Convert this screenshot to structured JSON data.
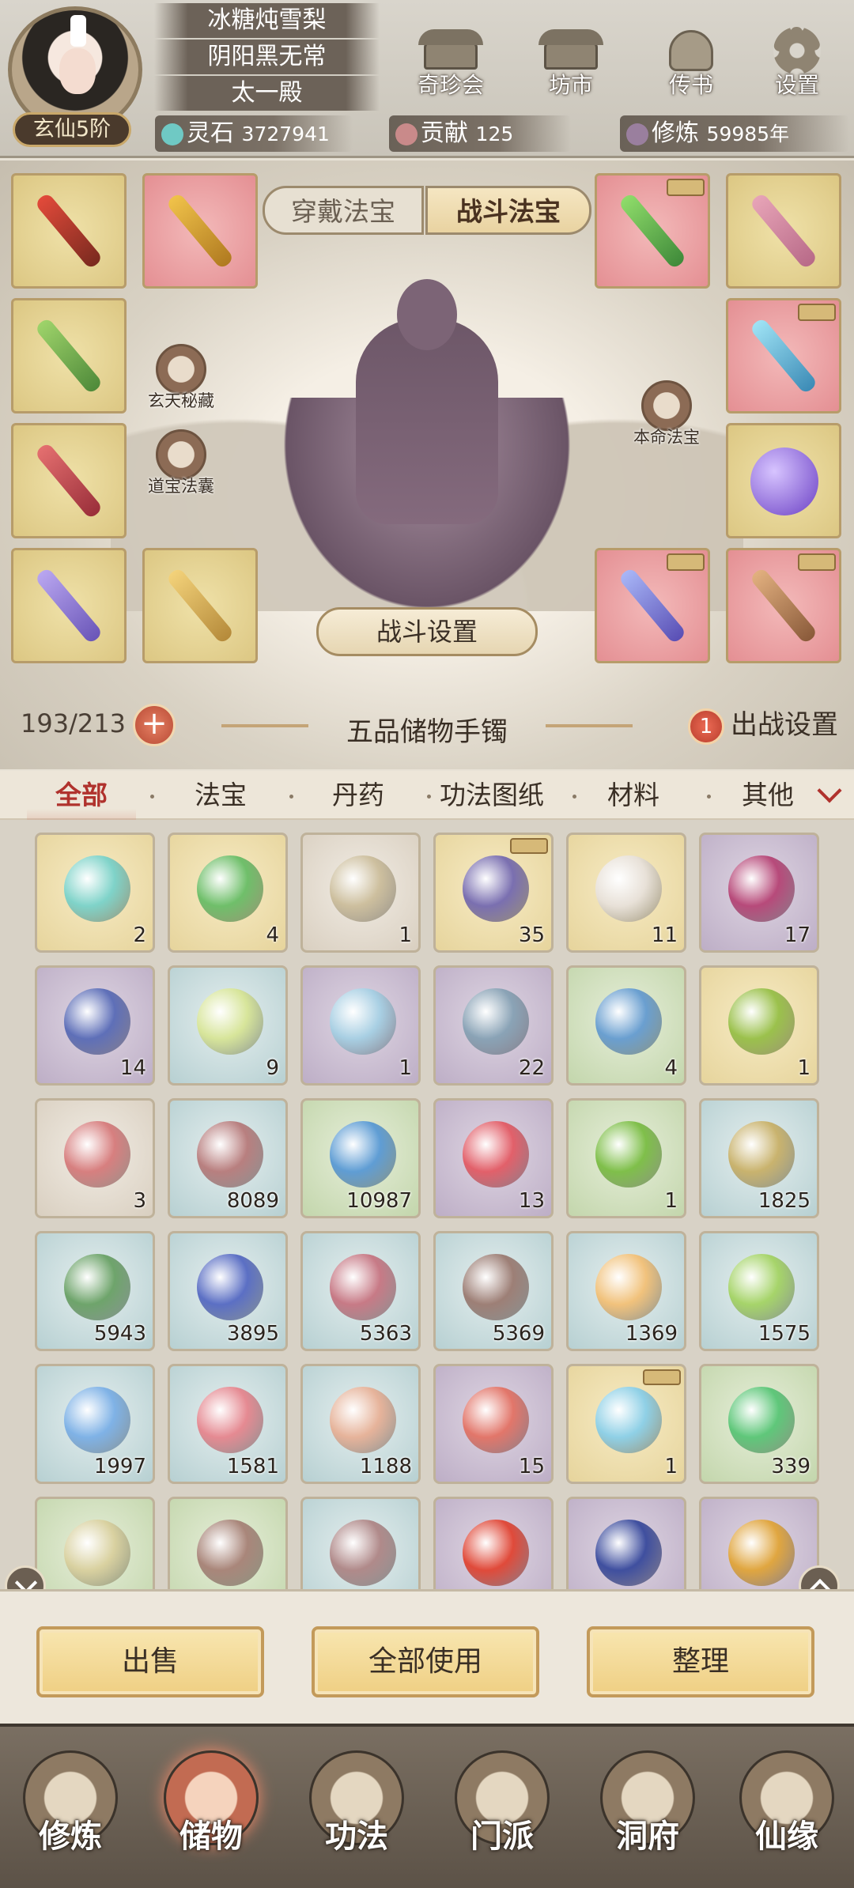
{
  "player": {
    "names": [
      "冰糖炖雪梨",
      "阴阳黑无常",
      "太一殿"
    ],
    "rank": "玄仙5阶"
  },
  "top_menu": [
    {
      "label": "奇珍会",
      "icon": "treasure-hall-icon"
    },
    {
      "label": "坊市",
      "icon": "market-icon"
    },
    {
      "label": "传书",
      "icon": "letter-scroll-icon"
    },
    {
      "label": "设置",
      "icon": "gear-icon"
    }
  ],
  "resources": {
    "spirit_stone": {
      "label": "灵石",
      "value": "3727941"
    },
    "contribution": {
      "label": "贡献",
      "value": "125"
    },
    "cultivation": {
      "label": "修炼",
      "value": "59985年"
    }
  },
  "equip": {
    "tab_wear": "穿戴法宝",
    "tab_battle": "战斗法宝",
    "left_circle_1": "玄天秘藏",
    "left_circle_2": "道宝法囊",
    "right_circle": "本命法宝",
    "battle_settings": "战斗设置"
  },
  "bag": {
    "capacity": "193/213",
    "title": "五品储物手镯",
    "deploy_count": "1",
    "deploy_label": "出战设置"
  },
  "categories": [
    "全部",
    "法宝",
    "丹药",
    "功法图纸",
    "材料",
    "其他"
  ],
  "items": [
    {
      "count": "2",
      "color": "c-gold",
      "hue": "#7fd3c9"
    },
    {
      "count": "4",
      "color": "c-gold",
      "hue": "#6fbf6a"
    },
    {
      "count": "1",
      "color": "c-gray",
      "hue": "#cdbf9e"
    },
    {
      "count": "35",
      "color": "c-gold",
      "hue": "#7a6fb0",
      "locked": true
    },
    {
      "count": "11",
      "color": "c-gold",
      "hue": "#e8e1d8"
    },
    {
      "count": "17",
      "color": "c-purple",
      "hue": "#b74a7a"
    },
    {
      "count": "14",
      "color": "c-purple",
      "hue": "#5e6fb8"
    },
    {
      "count": "9",
      "color": "c-blue",
      "hue": "#d7e59a"
    },
    {
      "count": "1",
      "color": "c-purple",
      "hue": "#a8cfe3"
    },
    {
      "count": "22",
      "color": "c-purple",
      "hue": "#8aa3b6"
    },
    {
      "count": "4",
      "color": "c-green",
      "hue": "#6a9fd0"
    },
    {
      "count": "1",
      "color": "c-gold",
      "hue": "#9bc14c"
    },
    {
      "count": "3",
      "color": "c-gray",
      "hue": "#d77f7f"
    },
    {
      "count": "8089",
      "color": "c-blue",
      "hue": "#b87f7f"
    },
    {
      "count": "10987",
      "color": "c-green",
      "hue": "#5f9dd4"
    },
    {
      "count": "13",
      "color": "c-purple",
      "hue": "#e2606a"
    },
    {
      "count": "1",
      "color": "c-green",
      "hue": "#7fbf4a"
    },
    {
      "count": "1825",
      "color": "c-blue",
      "hue": "#c9b36e"
    },
    {
      "count": "5943",
      "color": "c-blue",
      "hue": "#6ea46b"
    },
    {
      "count": "3895",
      "color": "c-blue",
      "hue": "#5b6fc4"
    },
    {
      "count": "5363",
      "color": "c-blue",
      "hue": "#c77a86"
    },
    {
      "count": "5369",
      "color": "c-blue",
      "hue": "#9d7f76"
    },
    {
      "count": "1369",
      "color": "c-blue",
      "hue": "#f1c27c"
    },
    {
      "count": "1575",
      "color": "c-blue",
      "hue": "#a6d46a"
    },
    {
      "count": "1997",
      "color": "c-blue",
      "hue": "#7fb2e6"
    },
    {
      "count": "1581",
      "color": "c-blue",
      "hue": "#e58a92"
    },
    {
      "count": "1188",
      "color": "c-blue",
      "hue": "#e6b39a"
    },
    {
      "count": "15",
      "color": "c-purple",
      "hue": "#e2766a"
    },
    {
      "count": "1",
      "color": "c-gold",
      "hue": "#8fd0e6",
      "locked": true
    },
    {
      "count": "339",
      "color": "c-green",
      "hue": "#5fc77a"
    },
    {
      "count": "",
      "color": "c-green",
      "hue": "#d9d1a0"
    },
    {
      "count": "",
      "color": "c-green",
      "hue": "#a9867a"
    },
    {
      "count": "",
      "color": "c-blue",
      "hue": "#b08a8a"
    },
    {
      "count": "",
      "color": "c-purple",
      "hue": "#e04a3a"
    },
    {
      "count": "",
      "color": "c-purple",
      "hue": "#3f4f9f"
    },
    {
      "count": "",
      "color": "c-purple",
      "hue": "#e0a640"
    }
  ],
  "actions": {
    "sell": "出售",
    "use_all": "全部使用",
    "sort": "整理"
  },
  "nav": [
    "修炼",
    "储物",
    "功法",
    "门派",
    "洞府",
    "仙缘"
  ],
  "colors": {
    "accent_red": "#b0322d",
    "gold_button": "#efcf83"
  }
}
